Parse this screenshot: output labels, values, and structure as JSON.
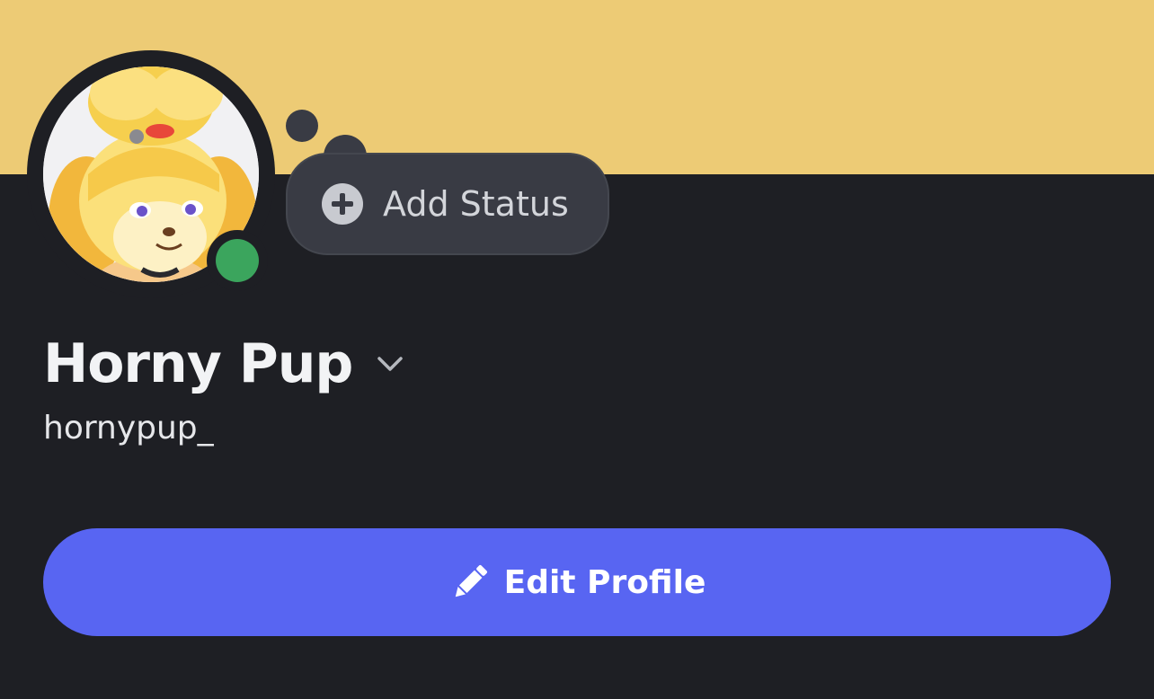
{
  "colors": {
    "banner": "#edcb75",
    "background": "#1e1f24",
    "status_online": "#3ba55d",
    "accent": "#5865f2"
  },
  "profile": {
    "display_name": "Horny Pup",
    "username": "hornypup_",
    "status": "online"
  },
  "status_bubble": {
    "label": "Add Status",
    "icon": "plus-circle-icon"
  },
  "actions": {
    "edit_profile_label": "Edit Profile",
    "edit_icon": "pencil-icon"
  }
}
